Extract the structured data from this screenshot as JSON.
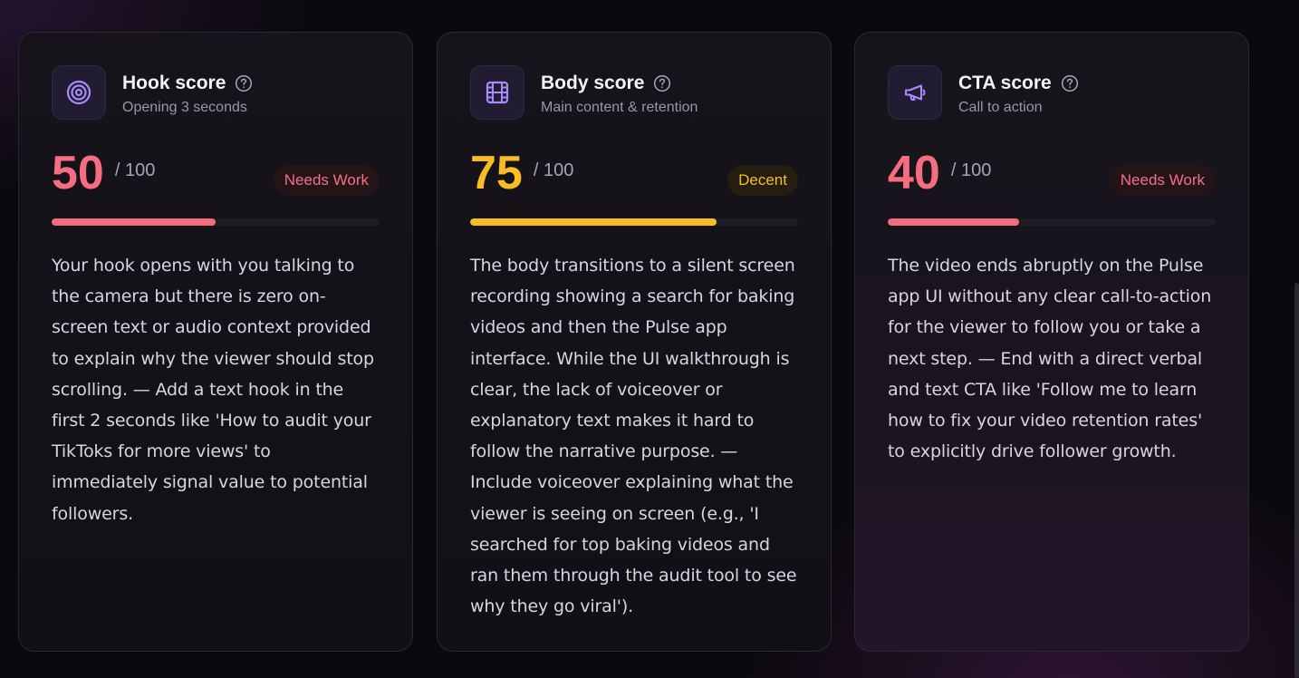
{
  "cards": [
    {
      "title": "Hook score",
      "subtitle": "Opening 3 seconds",
      "icon": "target-icon",
      "score": "50",
      "score_max": "/ 100",
      "progress": 0.5,
      "badge": "Needs Work",
      "status_color": "#f26c7e",
      "feedback": "Your hook opens with you talking to the camera but there is zero on-screen text or audio context provided to explain why the viewer should stop scrolling. — Add a text hook in the first 2 seconds like 'How to audit your TikToks for more views' to immediately signal value to potential followers."
    },
    {
      "title": "Body score",
      "subtitle": "Main content & retention",
      "icon": "film-icon",
      "score": "75",
      "score_max": "/ 100",
      "progress": 0.75,
      "badge": "Decent",
      "status_color": "#f9bd23",
      "feedback": "The body transitions to a silent screen recording showing a search for baking videos and then the Pulse app interface. While the UI walkthrough is clear, the lack of voiceover or explanatory text makes it hard to follow the narrative purpose. — Include voiceover explaining what the viewer is seeing on screen (e.g., 'I searched for top baking videos and ran them through the audit tool to see why they go viral')."
    },
    {
      "title": "CTA score",
      "subtitle": "Call to action",
      "icon": "megaphone-icon",
      "score": "40",
      "score_max": "/ 100",
      "progress": 0.4,
      "badge": "Needs Work",
      "status_color": "#f26c7e",
      "feedback": "The video ends abruptly on the Pulse app UI without any clear call-to-action for the viewer to follow you or take a next step. — End with a direct verbal and text CTA like 'Follow me to learn how to fix your video retention rates' to explicitly drive follower growth."
    }
  ],
  "colors": {
    "accent_icon": "#a78bfa",
    "needs_work": "#f26c7e",
    "decent": "#f9bd23"
  }
}
